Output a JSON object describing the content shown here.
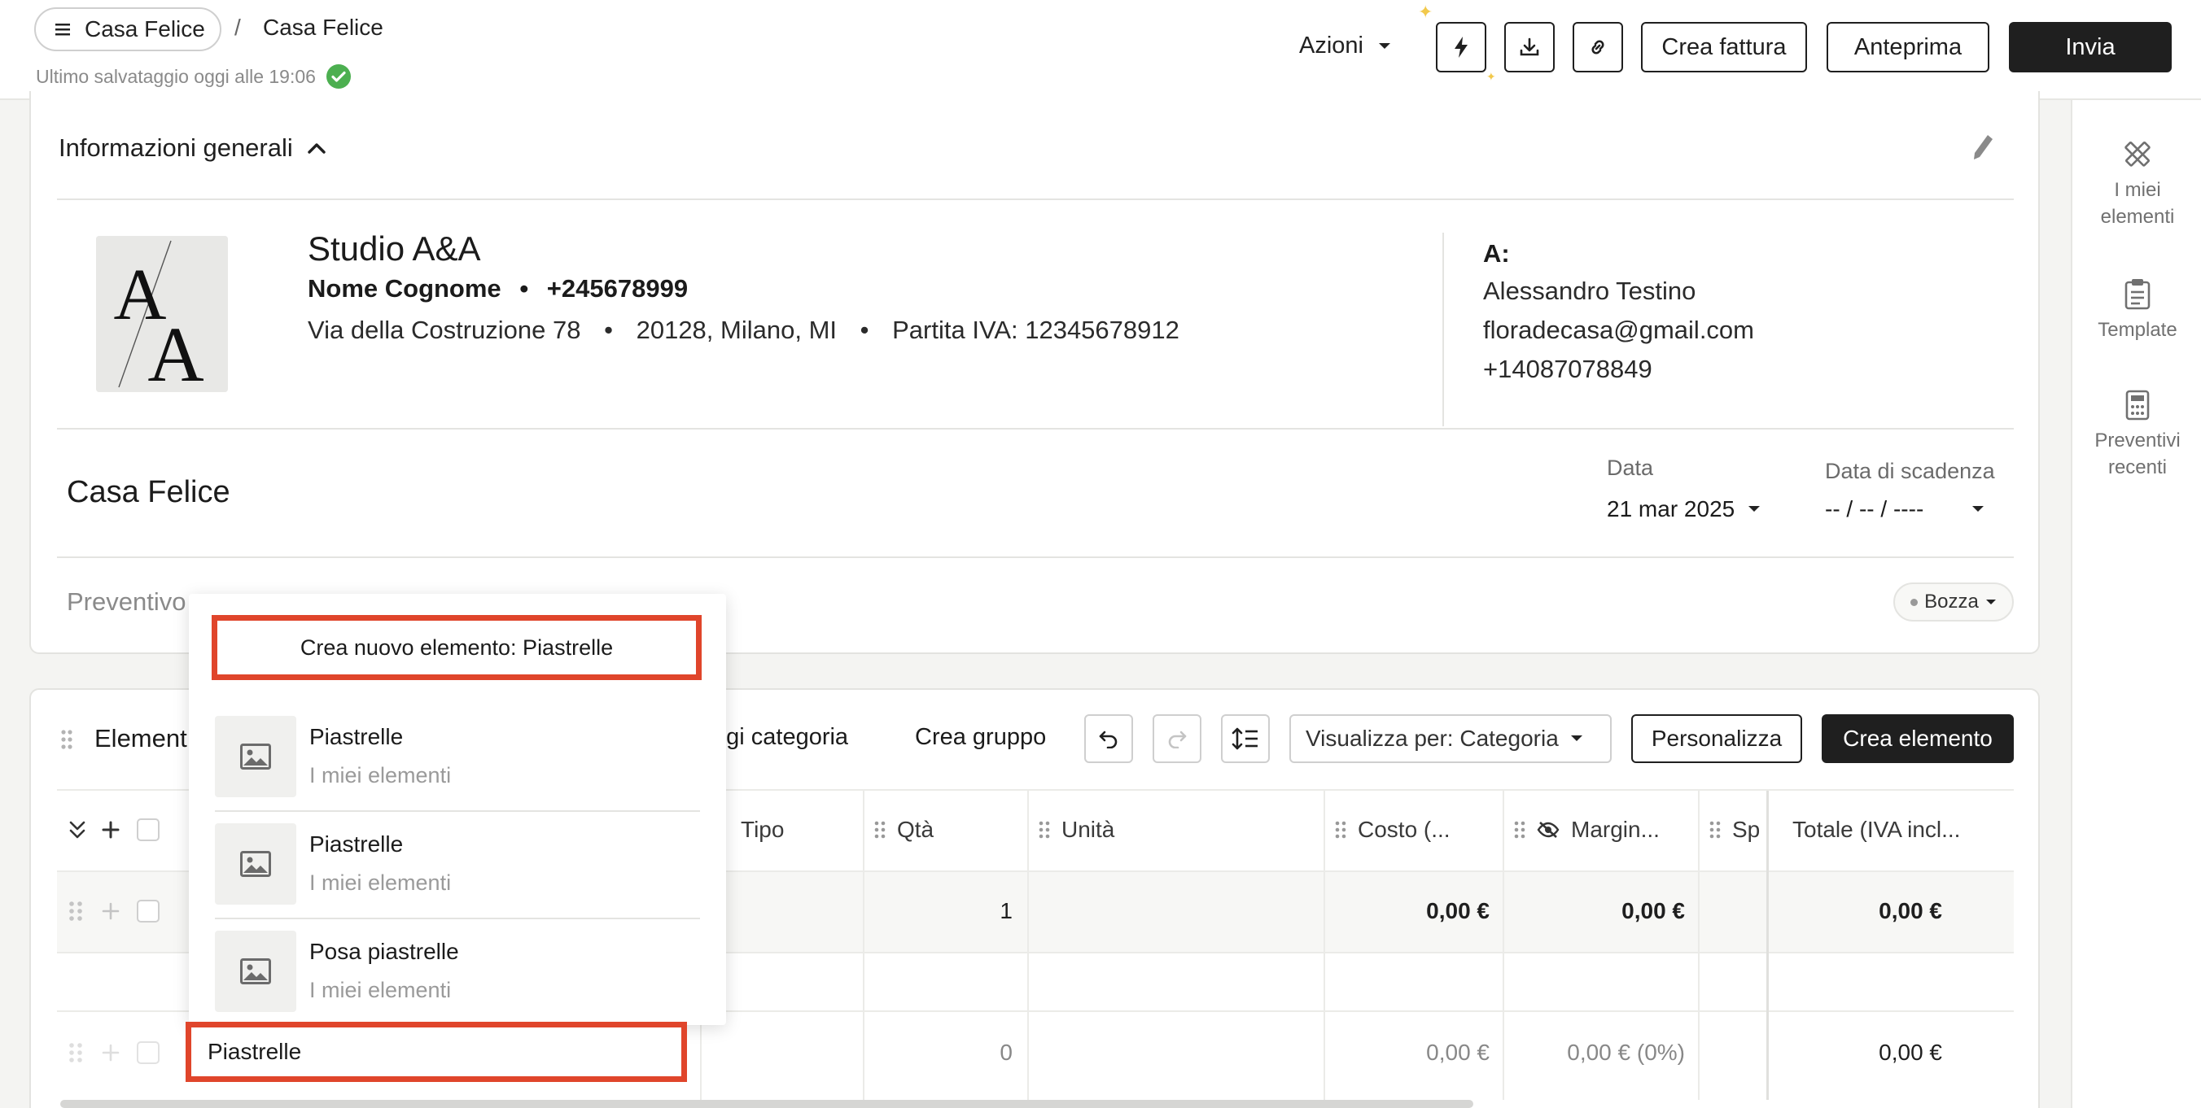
{
  "breadcrumb": {
    "root": "Casa Felice",
    "separator": "/",
    "current": "Casa Felice"
  },
  "save_status": "Ultimo salvataggio oggi alle 19:06",
  "toolbar": {
    "actions": "Azioni",
    "create_invoice": "Crea fattura",
    "preview": "Anteprima",
    "send": "Invia"
  },
  "side_panel": [
    {
      "label_1": "I miei",
      "label_2": "elementi",
      "icon": "ruler-pencil-icon"
    },
    {
      "label_1": "Template",
      "icon": "clipboard-icon"
    },
    {
      "label_1": "Preventivi",
      "label_2": "recenti",
      "icon": "calculator-icon"
    }
  ],
  "general_info": {
    "title": "Informazioni generali",
    "studio": {
      "name": "Studio A&A",
      "contact_name": "Nome Cognome",
      "phone": "+245678999",
      "address": "Via della Costruzione 78",
      "city": "20128, Milano, MI",
      "vat": "Partita IVA: 12345678912",
      "logo_text": "AA"
    },
    "client": {
      "label": "A:",
      "name": "Alessandro Testino",
      "email": "floradecasa@gmail.com",
      "phone": "+14087078849"
    },
    "project_title": "Casa Felice",
    "date": {
      "label": "Data",
      "value": "21 mar 2025"
    },
    "due_date": {
      "label": "Data di scadenza",
      "value": "-- / -- / ----"
    },
    "quote_label": "Preventivo",
    "status": "Bozza"
  },
  "elements": {
    "title": "Element",
    "add_category": "ngi categoria",
    "create_group": "Crea gruppo",
    "view_by": "Visualizza per: Categoria",
    "customize": "Personalizza",
    "create_element": "Crea elemento",
    "columns": {
      "type": "Tipo",
      "qty": "Qtà",
      "unit": "Unità",
      "cost": "Costo (...",
      "margin": "Margin...",
      "sp": "Sp",
      "total": "Totale (IVA incl..."
    },
    "rows": [
      {
        "qty": "1",
        "cost": "0,00 €",
        "margin": "0,00 €",
        "total": "0,00 €"
      },
      {
        "qty": "0",
        "cost": "0,00 €",
        "margin": "0,00 € (0%)",
        "total": "0,00 €"
      }
    ]
  },
  "dropdown": {
    "create_new": "Crea nuovo elemento: Piastrelle",
    "suggestions": [
      {
        "name": "Piastrelle",
        "source": "I miei elementi"
      },
      {
        "name": "Piastrelle",
        "source": "I miei elementi"
      },
      {
        "name": "Posa piastrelle",
        "source": "I miei elementi"
      }
    ]
  },
  "search_input_value": "Piastrelle",
  "colors": {
    "accent_dark": "#1f1f1f",
    "highlight": "#e0452b",
    "success": "#4caf50"
  }
}
